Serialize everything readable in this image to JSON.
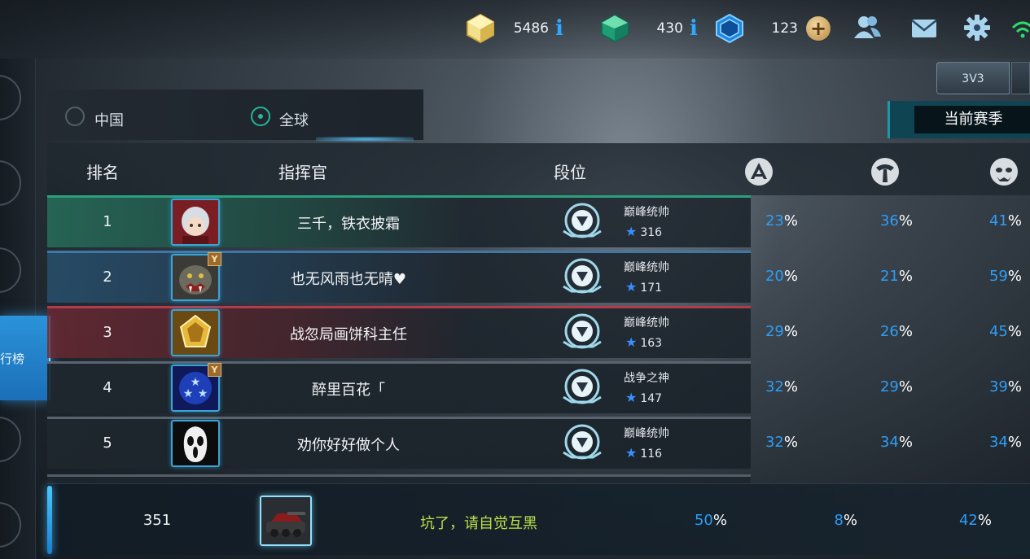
{
  "currencies": [
    {
      "name": "gold",
      "icon": "gold-cube-icon",
      "value": "5486",
      "action": "i"
    },
    {
      "name": "crystal",
      "icon": "green-crystal-icon",
      "value": "430",
      "action": "i"
    },
    {
      "name": "diamond",
      "icon": "blue-diamond-icon",
      "value": "123",
      "action": "+"
    }
  ],
  "top_icons": [
    "friends-icon",
    "mail-icon",
    "settings-gear-icon",
    "wifi-icon"
  ],
  "mode_tab": "3V3",
  "season_button": "当前赛季",
  "side_nav_active": "行榜",
  "regions": [
    {
      "label": "中国",
      "selected": false
    },
    {
      "label": "全球",
      "selected": true
    }
  ],
  "table": {
    "headers": {
      "rank": "排名",
      "commander": "指挥官",
      "tier": "段位"
    },
    "stat_icons": [
      "faction-1-icon",
      "faction-2-icon",
      "faction-3-icon"
    ],
    "rows": [
      {
        "rank": "1",
        "name": "三千，铁衣披霜",
        "tier": "巅峰统帅",
        "stars": "316",
        "p1": "23",
        "p2": "36",
        "p3": "41",
        "avatar": "silver-hair-character",
        "badge": false,
        "line": "#2aa07e"
      },
      {
        "rank": "2",
        "name": "也无风雨也无晴♥",
        "tier": "巅峰统帅",
        "stars": "171",
        "p1": "20",
        "p2": "21",
        "p3": "59",
        "avatar": "orc-beast",
        "badge": true,
        "line": "#3f78a8"
      },
      {
        "rank": "3",
        "name": "战忽局画饼科主任",
        "tier": "巅峰统帅",
        "stars": "163",
        "p1": "29",
        "p2": "26",
        "p3": "45",
        "avatar": "gold-emblem",
        "badge": false,
        "line": "#b23b4d"
      },
      {
        "rank": "4",
        "name": "醉里百花「",
        "tier": "战争之神",
        "stars": "147",
        "p1": "32",
        "p2": "29",
        "p3": "39",
        "avatar": "blue-stars",
        "badge": true,
        "line": "#5a6470"
      },
      {
        "rank": "5",
        "name": "劝你好好做个人",
        "tier": "巅峰统帅",
        "stars": "116",
        "p1": "32",
        "p2": "34",
        "p3": "34",
        "avatar": "ghost-mask",
        "badge": false,
        "line": "#5a6470"
      }
    ],
    "pct_unit": "%"
  },
  "my_row": {
    "rank": "351",
    "name": "坑了，请自觉互黑",
    "p1": "50",
    "p2": "8",
    "p3": "42",
    "avatar": "red-tank"
  }
}
